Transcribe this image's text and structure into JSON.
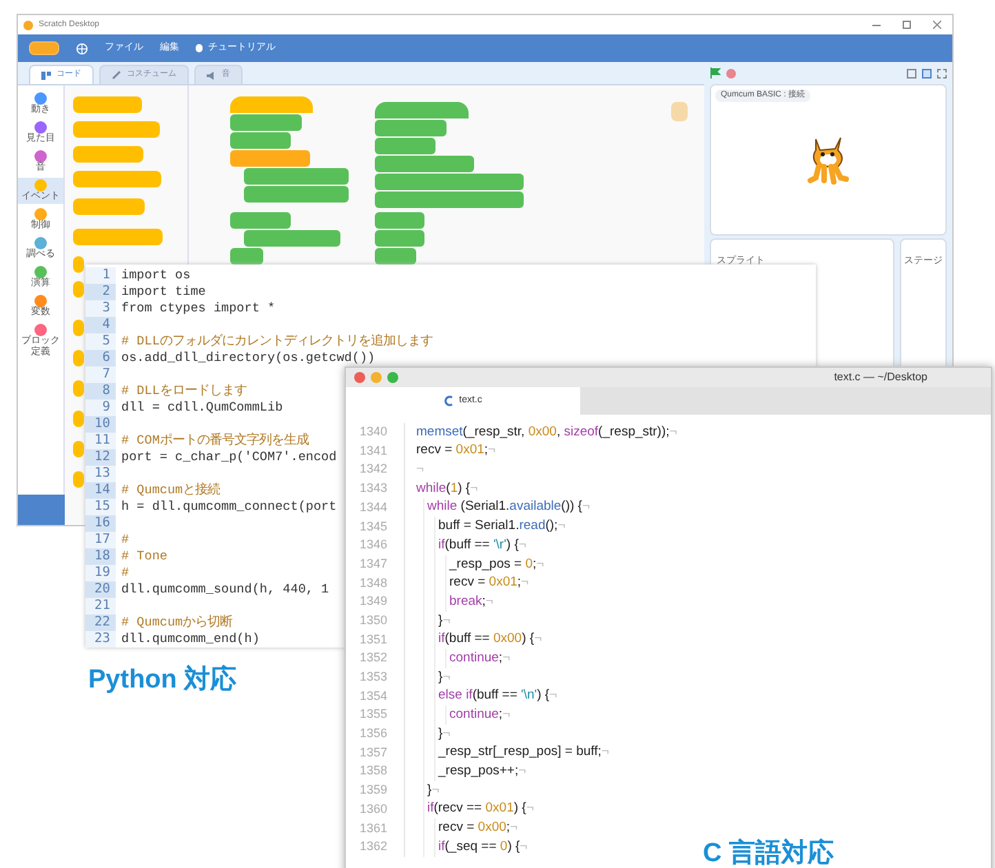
{
  "scratch": {
    "title": "Scratch Desktop",
    "menu": [
      {
        "label": "ファイル",
        "kind": "text"
      },
      {
        "label": "編集",
        "kind": "text"
      },
      {
        "label": "チュートリアル",
        "kind": "tutorial"
      }
    ],
    "tabs": [
      {
        "label": "コード",
        "selected": true,
        "kind": "code"
      },
      {
        "label": "コスチューム",
        "selected": false,
        "kind": "costume"
      },
      {
        "label": "音",
        "selected": false,
        "kind": "sound"
      }
    ],
    "categories": [
      {
        "label": "動き",
        "color": "#4c97ff",
        "selected": false
      },
      {
        "label": "見た目",
        "color": "#9966ff",
        "selected": false
      },
      {
        "label": "音",
        "color": "#cf63cf",
        "selected": false
      },
      {
        "label": "イベント",
        "color": "#ffbf00",
        "selected": true
      },
      {
        "label": "制御",
        "color": "#ffab19",
        "selected": false
      },
      {
        "label": "調べる",
        "color": "#5cb1d6",
        "selected": false
      },
      {
        "label": "演算",
        "color": "#59c059",
        "selected": false
      },
      {
        "label": "変数",
        "color": "#ff8c1a",
        "selected": false
      },
      {
        "label": "ブロック定義",
        "color": "#ff6680",
        "selected": false
      }
    ],
    "stage_label": "Qumcum BASIC : 接続",
    "sprite_panel": "スプライト",
    "stage_panel": "ステージ"
  },
  "python": {
    "lines": [
      {
        "no": "1",
        "text": "import os",
        "kind": "code"
      },
      {
        "no": "2",
        "text": "import time",
        "kind": "code"
      },
      {
        "no": "3",
        "text": "from ctypes import *",
        "kind": "code"
      },
      {
        "no": "4",
        "kind": "blank"
      },
      {
        "no": "5",
        "text": "# DLLのフォルダにカレントディレクトリを追加します",
        "kind": "comment"
      },
      {
        "no": "6",
        "text": "os.add_dll_directory(os.getcwd())",
        "kind": "code"
      },
      {
        "no": "7",
        "kind": "blank"
      },
      {
        "no": "8",
        "text": "# DLLをロードします",
        "kind": "comment"
      },
      {
        "no": "9",
        "text": "dll = cdll.QumCommLib",
        "kind": "code"
      },
      {
        "no": "10",
        "kind": "blank"
      },
      {
        "no": "11",
        "text": "# COMポートの番号文字列を生成",
        "kind": "comment"
      },
      {
        "no": "12",
        "text": "port = c_char_p('COM7'.encod",
        "kind": "code"
      },
      {
        "no": "13",
        "kind": "blank"
      },
      {
        "no": "14",
        "text": "# Qumcumと接続",
        "kind": "comment"
      },
      {
        "no": "15",
        "text": "h = dll.qumcomm_connect(port",
        "kind": "code"
      },
      {
        "no": "16",
        "kind": "blank"
      },
      {
        "no": "17",
        "text": "#",
        "kind": "comment"
      },
      {
        "no": "18",
        "text": "# Tone",
        "kind": "comment"
      },
      {
        "no": "19",
        "text": "#",
        "kind": "comment"
      },
      {
        "no": "20",
        "text": "dll.qumcomm_sound(h, 440, 1",
        "kind": "code"
      },
      {
        "no": "21",
        "kind": "blank"
      },
      {
        "no": "22",
        "text": "# Qumcumから切断",
        "kind": "comment"
      },
      {
        "no": "23",
        "text": "dll.qumcomm_end(h)",
        "kind": "code"
      }
    ]
  },
  "c_editor": {
    "title": "text.c — ~/Desktop",
    "tab": "text.c",
    "lines": [
      {
        "no": "1340",
        "parts": [
          {
            "text": "memset",
            "kind": "func"
          },
          {
            "text": "(_resp_str, ",
            "kind": "plain"
          },
          {
            "text": "0x00",
            "kind": "number"
          },
          {
            "text": ", ",
            "kind": "plain"
          },
          {
            "text": "sizeof",
            "kind": "keyword"
          },
          {
            "text": "(_resp_str));",
            "kind": "plain"
          },
          {
            "text": "¬",
            "kind": "mark"
          }
        ]
      },
      {
        "no": "1341",
        "parts": [
          {
            "text": "recv = ",
            "kind": "plain"
          },
          {
            "text": "0x01",
            "kind": "number"
          },
          {
            "text": ";",
            "kind": "plain"
          },
          {
            "text": "¬",
            "kind": "mark"
          }
        ]
      },
      {
        "no": "1342",
        "parts": [
          {
            "text": "¬",
            "kind": "mark"
          }
        ]
      },
      {
        "no": "1343",
        "parts": [
          {
            "text": "while",
            "kind": "keyword"
          },
          {
            "text": "(",
            "kind": "plain"
          },
          {
            "text": "1",
            "kind": "number"
          },
          {
            "text": ") {",
            "kind": "plain"
          },
          {
            "text": "¬",
            "kind": "mark"
          }
        ],
        "children": [
          {
            "no": "1344",
            "parts": [
              {
                "text": "while",
                "kind": "keyword"
              },
              {
                "text": " (Serial1.",
                "kind": "plain"
              },
              {
                "text": "available",
                "kind": "func"
              },
              {
                "text": "()) {",
                "kind": "plain"
              },
              {
                "text": "¬",
                "kind": "mark"
              }
            ],
            "children": [
              {
                "no": "1345",
                "parts": [
                  {
                    "text": "buff = Serial1.",
                    "kind": "plain"
                  },
                  {
                    "text": "read",
                    "kind": "func"
                  },
                  {
                    "text": "();",
                    "kind": "plain"
                  },
                  {
                    "text": "¬",
                    "kind": "mark"
                  }
                ]
              },
              {
                "no": "1346",
                "parts": [
                  {
                    "text": "if",
                    "kind": "keyword"
                  },
                  {
                    "text": "(buff == ",
                    "kind": "plain"
                  },
                  {
                    "text": "'\\r'",
                    "kind": "char"
                  },
                  {
                    "text": ") {",
                    "kind": "plain"
                  },
                  {
                    "text": "¬",
                    "kind": "mark"
                  }
                ],
                "children": [
                  {
                    "no": "1347",
                    "parts": [
                      {
                        "text": "_resp_pos = ",
                        "kind": "plain"
                      },
                      {
                        "text": "0",
                        "kind": "number"
                      },
                      {
                        "text": ";",
                        "kind": "plain"
                      },
                      {
                        "text": "¬",
                        "kind": "mark"
                      }
                    ]
                  },
                  {
                    "no": "1348",
                    "parts": [
                      {
                        "text": "recv = ",
                        "kind": "plain"
                      },
                      {
                        "text": "0x01",
                        "kind": "number"
                      },
                      {
                        "text": ";",
                        "kind": "plain"
                      },
                      {
                        "text": "¬",
                        "kind": "mark"
                      }
                    ]
                  },
                  {
                    "no": "1349",
                    "parts": [
                      {
                        "text": "break",
                        "kind": "keyword"
                      },
                      {
                        "text": ";",
                        "kind": "plain"
                      },
                      {
                        "text": "¬",
                        "kind": "mark"
                      }
                    ]
                  }
                ]
              },
              {
                "no": "1350",
                "parts": [
                  {
                    "text": "}",
                    "kind": "plain"
                  },
                  {
                    "text": "¬",
                    "kind": "mark"
                  }
                ]
              },
              {
                "no": "1351",
                "parts": [
                  {
                    "text": "if",
                    "kind": "keyword"
                  },
                  {
                    "text": "(buff == ",
                    "kind": "plain"
                  },
                  {
                    "text": "0x00",
                    "kind": "number"
                  },
                  {
                    "text": ") {",
                    "kind": "plain"
                  },
                  {
                    "text": "¬",
                    "kind": "mark"
                  }
                ],
                "children": [
                  {
                    "no": "1352",
                    "parts": [
                      {
                        "text": "continue",
                        "kind": "keyword"
                      },
                      {
                        "text": ";",
                        "kind": "plain"
                      },
                      {
                        "text": "¬",
                        "kind": "mark"
                      }
                    ]
                  }
                ]
              },
              {
                "no": "1353",
                "parts": [
                  {
                    "text": "}",
                    "kind": "plain"
                  },
                  {
                    "text": "¬",
                    "kind": "mark"
                  }
                ]
              },
              {
                "no": "1354",
                "parts": [
                  {
                    "text": "else if",
                    "kind": "keyword"
                  },
                  {
                    "text": "(buff == ",
                    "kind": "plain"
                  },
                  {
                    "text": "'\\n'",
                    "kind": "char"
                  },
                  {
                    "text": ") {",
                    "kind": "plain"
                  },
                  {
                    "text": "¬",
                    "kind": "mark"
                  }
                ],
                "children": [
                  {
                    "no": "1355",
                    "parts": [
                      {
                        "text": "continue",
                        "kind": "keyword"
                      },
                      {
                        "text": ";",
                        "kind": "plain"
                      },
                      {
                        "text": "¬",
                        "kind": "mark"
                      }
                    ]
                  }
                ]
              },
              {
                "no": "1356",
                "parts": [
                  {
                    "text": "}",
                    "kind": "plain"
                  },
                  {
                    "text": "¬",
                    "kind": "mark"
                  }
                ]
              },
              {
                "no": "1357",
                "parts": [
                  {
                    "text": "_resp_str[_resp_pos] = buff;",
                    "kind": "plain"
                  },
                  {
                    "text": "¬",
                    "kind": "mark"
                  }
                ]
              },
              {
                "no": "1358",
                "parts": [
                  {
                    "text": "_resp_pos++;",
                    "kind": "plain"
                  },
                  {
                    "text": "¬",
                    "kind": "mark"
                  }
                ]
              }
            ]
          },
          {
            "no": "1359",
            "parts": [
              {
                "text": "}",
                "kind": "plain"
              },
              {
                "text": "¬",
                "kind": "mark"
              }
            ]
          },
          {
            "no": "1360",
            "parts": [
              {
                "text": "if",
                "kind": "keyword"
              },
              {
                "text": "(recv == ",
                "kind": "plain"
              },
              {
                "text": "0x01",
                "kind": "number"
              },
              {
                "text": ") {",
                "kind": "plain"
              },
              {
                "text": "¬",
                "kind": "mark"
              }
            ],
            "children": [
              {
                "no": "1361",
                "parts": [
                  {
                    "text": "recv = ",
                    "kind": "plain"
                  },
                  {
                    "text": "0x00",
                    "kind": "number"
                  },
                  {
                    "text": ";",
                    "kind": "plain"
                  },
                  {
                    "text": "¬",
                    "kind": "mark"
                  }
                ]
              },
              {
                "no": "1362",
                "parts": [
                  {
                    "text": "if",
                    "kind": "keyword"
                  },
                  {
                    "text": "(_seq == ",
                    "kind": "plain"
                  },
                  {
                    "text": "0",
                    "kind": "number"
                  },
                  {
                    "text": ") {",
                    "kind": "plain"
                  },
                  {
                    "text": "¬",
                    "kind": "mark"
                  }
                ]
              }
            ]
          }
        ]
      }
    ]
  },
  "captions": [
    {
      "text": "Python 対応",
      "kind": "python"
    },
    {
      "text": "C 言語対応",
      "kind": "c"
    }
  ]
}
